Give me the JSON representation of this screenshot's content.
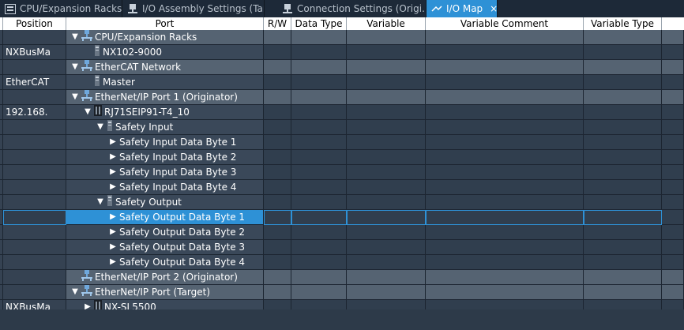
{
  "tabs": [
    {
      "label": "CPU/Expansion Racks",
      "icon": "rack-icon"
    },
    {
      "label": "I/O Assembly Settings (Tar...",
      "icon": "assembly-icon"
    },
    {
      "label": "Connection Settings (Origi...",
      "icon": "connection-icon"
    },
    {
      "label": "I/O Map",
      "icon": "io-map-icon",
      "close": "×"
    }
  ],
  "columns": {
    "position": "Position",
    "port": "Port",
    "rw": "R/W",
    "data_type": "Data Type",
    "variable": "Variable",
    "variable_comment": "Variable Comment",
    "variable_type": "Variable Type"
  },
  "rows": [
    {
      "position": "",
      "port": "CPU/Expansion Racks",
      "toggle": "▼",
      "icon": "network-icon",
      "indent": 0,
      "group": true
    },
    {
      "position": "NXBusMa",
      "port": "NX102-9000",
      "toggle": "",
      "icon": "device-icon",
      "indent": 1,
      "group": false
    },
    {
      "position": "",
      "port": "EtherCAT Network",
      "toggle": "▼",
      "icon": "network-icon",
      "indent": 0,
      "group": true
    },
    {
      "position": "EtherCAT",
      "port": "Master",
      "toggle": "",
      "icon": "device-icon",
      "indent": 1,
      "group": false
    },
    {
      "position": "",
      "port": "EtherNet/IP Port 1 (Originator)",
      "toggle": "▼",
      "icon": "network-icon",
      "indent": 0,
      "group": true
    },
    {
      "position": "192.168.",
      "port": "RJ71SEIP91-T4_10",
      "toggle": "▼",
      "icon": "module-icon",
      "indent": 1,
      "group": false
    },
    {
      "position": "",
      "port": "Safety Input",
      "toggle": "▼",
      "icon": "device-icon",
      "indent": 2,
      "group": false
    },
    {
      "position": "",
      "port": "Safety Input Data Byte 1",
      "toggle": "▶",
      "icon": "",
      "indent": 3,
      "group": false
    },
    {
      "position": "",
      "port": "Safety Input Data Byte 2",
      "toggle": "▶",
      "icon": "",
      "indent": 3,
      "group": false
    },
    {
      "position": "",
      "port": "Safety Input Data Byte 3",
      "toggle": "▶",
      "icon": "",
      "indent": 3,
      "group": false
    },
    {
      "position": "",
      "port": "Safety Input Data Byte 4",
      "toggle": "▶",
      "icon": "",
      "indent": 3,
      "group": false
    },
    {
      "position": "",
      "port": "Safety Output",
      "toggle": "▼",
      "icon": "device-icon",
      "indent": 2,
      "group": false
    },
    {
      "position": "",
      "port": "Safety Output Data Byte 1",
      "toggle": "▶",
      "icon": "",
      "indent": 3,
      "group": false,
      "selected": true
    },
    {
      "position": "",
      "port": "Safety Output Data Byte 2",
      "toggle": "▶",
      "icon": "",
      "indent": 3,
      "group": false
    },
    {
      "position": "",
      "port": "Safety Output Data Byte 3",
      "toggle": "▶",
      "icon": "",
      "indent": 3,
      "group": false
    },
    {
      "position": "",
      "port": "Safety Output Data Byte 4",
      "toggle": "▶",
      "icon": "",
      "indent": 3,
      "group": false
    },
    {
      "position": "",
      "port": "EtherNet/IP Port 2 (Originator)",
      "toggle": "",
      "icon": "network-icon",
      "indent": 0,
      "group": true
    },
    {
      "position": "",
      "port": "EtherNet/IP Port (Target)",
      "toggle": "▼",
      "icon": "network-icon",
      "indent": 0,
      "group": true
    },
    {
      "position": "NXBusMa",
      "port": "NX-SL5500",
      "toggle": "▶",
      "icon": "module-icon",
      "indent": 1,
      "group": false
    }
  ],
  "colors": {
    "accent": "#2e91d6",
    "background": "#2d3a49",
    "group_row": "#556372",
    "network_icon": "#6fa8dc"
  }
}
